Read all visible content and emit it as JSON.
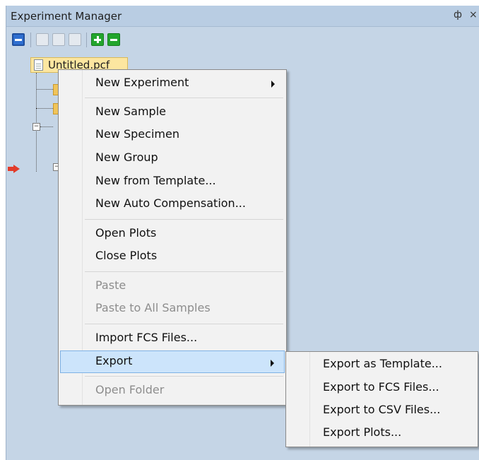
{
  "window": {
    "title": "Experiment Manager",
    "pin_glyph": "ф",
    "close_glyph": "×"
  },
  "toolbar": {
    "icons": [
      "new-experiment-icon",
      "copy-icon",
      "paste-icon",
      "document-icon",
      "add-icon",
      "remove-icon"
    ]
  },
  "tree": {
    "root_label": "Untitled.pcf",
    "expander_glyph": "−",
    "marker_icon": "red-arrow-icon"
  },
  "context_menu": {
    "items": [
      {
        "label": "New Experiment",
        "submenu": true,
        "disabled": false
      },
      {
        "label": "New Sample",
        "disabled": false
      },
      {
        "label": "New Specimen",
        "disabled": false
      },
      {
        "label": "New Group",
        "disabled": false
      },
      {
        "label": "New from Template...",
        "disabled": false
      },
      {
        "label": "New Auto Compensation...",
        "disabled": false
      },
      {
        "label": "Open Plots",
        "disabled": false
      },
      {
        "label": "Close Plots",
        "disabled": false
      },
      {
        "label": "Paste",
        "disabled": true
      },
      {
        "label": "Paste to All Samples",
        "disabled": true
      },
      {
        "label": "Import FCS Files...",
        "disabled": false
      },
      {
        "label": "Export",
        "submenu": true,
        "highlighted": true,
        "disabled": false
      },
      {
        "label": "Open Folder",
        "disabled": true
      }
    ]
  },
  "export_submenu": {
    "items": [
      {
        "label": "Export as Template..."
      },
      {
        "label": "Export to FCS Files..."
      },
      {
        "label": "Export to CSV Files..."
      },
      {
        "label": "Export Plots..."
      }
    ]
  },
  "colors": {
    "panel_bg": "#c5d5e6",
    "highlight": "#cce4fb",
    "disabled_text": "#8d8d8d"
  }
}
